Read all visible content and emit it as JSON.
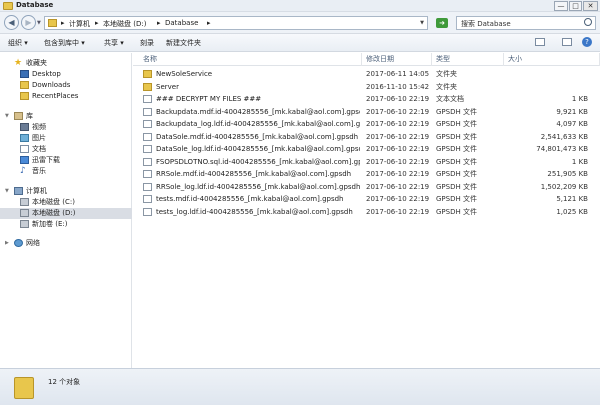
{
  "window": {
    "title": "Database",
    "min": "—",
    "max": "□",
    "close": "✕"
  },
  "address": {
    "crumbs": [
      "计算机",
      "本地磁盘 (D:)",
      "Database"
    ],
    "sep": "▸"
  },
  "search": {
    "placeholder": "搜索 Database"
  },
  "toolbar": {
    "organize": "组织 ▾",
    "include": "包含到库中 ▾",
    "share": "共享 ▾",
    "burn": "刻录",
    "newfolder": "新建文件夹",
    "help": "?"
  },
  "sidebar": {
    "favorites": "收藏夹",
    "fav_items": [
      "Desktop",
      "Downloads",
      "RecentPlaces"
    ],
    "libraries": "库",
    "lib_items": [
      "视频",
      "图片",
      "文档",
      "迅雷下载",
      "音乐"
    ],
    "computer": "计算机",
    "drives": [
      "本地磁盘 (C:)",
      "本地磁盘 (D:)",
      "新加卷 (E:)"
    ],
    "network": "网络"
  },
  "columns": {
    "name": "名称",
    "date": "修改日期",
    "type": "类型",
    "size": "大小"
  },
  "files": [
    {
      "name": "NewSoleService",
      "date": "2017-06-11 14:05",
      "type": "文件夹",
      "size": "",
      "kind": "folder"
    },
    {
      "name": "Server",
      "date": "2016-11-10 15:42",
      "type": "文件夹",
      "size": "",
      "kind": "folder"
    },
    {
      "name": "### DECRYPT MY FILES ###",
      "date": "2017-06-10 22:19",
      "type": "文本文档",
      "size": "1 KB",
      "kind": "file"
    },
    {
      "name": "Backupdata.mdf.id-4004285556_[mk.kabal@aol.com].gpsdh",
      "date": "2017-06-10 22:19",
      "type": "GPSDH 文件",
      "size": "9,921 KB",
      "kind": "file"
    },
    {
      "name": "Backupdata_log.ldf.id-4004285556_[mk.kabal@aol.com].gpsdh",
      "date": "2017-06-10 22:19",
      "type": "GPSDH 文件",
      "size": "4,097 KB",
      "kind": "file"
    },
    {
      "name": "DataSole.mdf.id-4004285556_[mk.kabal@aol.com].gpsdh",
      "date": "2017-06-10 22:19",
      "type": "GPSDH 文件",
      "size": "2,541,633 KB",
      "kind": "file"
    },
    {
      "name": "DataSole_log.ldf.id-4004285556_[mk.kabal@aol.com].gpsdh",
      "date": "2017-06-10 22:19",
      "type": "GPSDH 文件",
      "size": "74,801,473 KB",
      "kind": "file"
    },
    {
      "name": "FSOPSDLOTNO.sql.id-4004285556_[mk.kabal@aol.com].gpsdh",
      "date": "2017-06-10 22:19",
      "type": "GPSDH 文件",
      "size": "1 KB",
      "kind": "file"
    },
    {
      "name": "RRSole.mdf.id-4004285556_[mk.kabal@aol.com].gpsdh",
      "date": "2017-06-10 22:19",
      "type": "GPSDH 文件",
      "size": "251,905 KB",
      "kind": "file"
    },
    {
      "name": "RRSole_log.ldf.id-4004285556_[mk.kabal@aol.com].gpsdh",
      "date": "2017-06-10 22:19",
      "type": "GPSDH 文件",
      "size": "1,502,209 KB",
      "kind": "file"
    },
    {
      "name": "tests.mdf.id-4004285556_[mk.kabal@aol.com].gpsdh",
      "date": "2017-06-10 22:19",
      "type": "GPSDH 文件",
      "size": "5,121 KB",
      "kind": "file"
    },
    {
      "name": "tests_log.ldf.id-4004285556_[mk.kabal@aol.com].gpsdh",
      "date": "2017-06-10 22:19",
      "type": "GPSDH 文件",
      "size": "1,025 KB",
      "kind": "file"
    }
  ],
  "status": {
    "count": "12 个对象"
  }
}
